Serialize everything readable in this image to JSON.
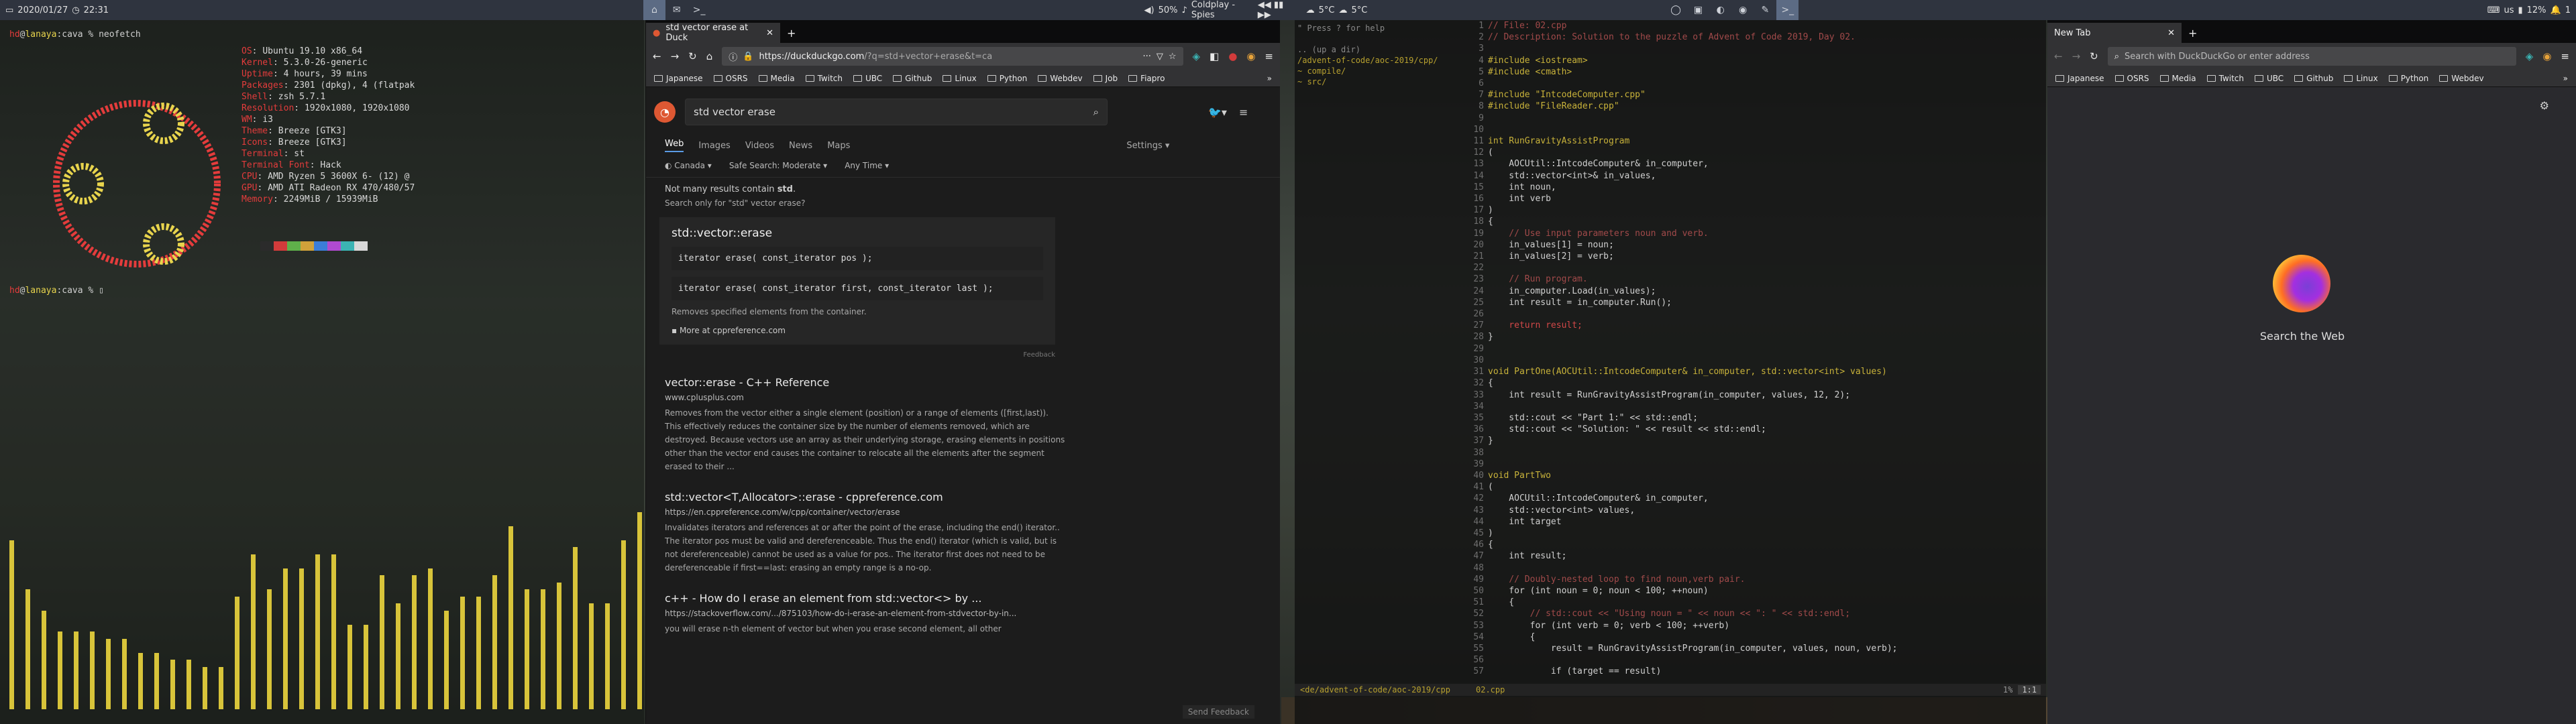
{
  "topbar": {
    "date": "2020/01/27",
    "time": "22:31",
    "media": {
      "volume": "50%",
      "song": "Coldplay - Spies"
    },
    "weather1": "5°C",
    "weather2": "5°C",
    "tray": {
      "keyboard": "us",
      "battery": "12%",
      "notifications": "1"
    }
  },
  "terminal1": {
    "prompt_cmd": "neofetch",
    "user": "hd",
    "host": "lanaya",
    "sep": "@",
    "dir": "cava",
    "info": [
      {
        "k": "OS",
        "v": "Ubuntu 19.10 x86_64"
      },
      {
        "k": "Kernel",
        "v": "5.3.0-26-generic"
      },
      {
        "k": "Uptime",
        "v": "4 hours, 39 mins"
      },
      {
        "k": "Packages",
        "v": "2301 (dpkg), 4 (flatpak"
      },
      {
        "k": "Shell",
        "v": "zsh 5.7.1"
      },
      {
        "k": "Resolution",
        "v": "1920x1080, 1920x1080"
      },
      {
        "k": "WM",
        "v": "i3"
      },
      {
        "k": "Theme",
        "v": "Breeze [GTK3]"
      },
      {
        "k": "Icons",
        "v": "Breeze [GTK3]"
      },
      {
        "k": "Terminal",
        "v": "st"
      },
      {
        "k": "Terminal Font",
        "v": "Hack"
      },
      {
        "k": "CPU",
        "v": "AMD Ryzen 5 3600X 6- (12) @"
      },
      {
        "k": "GPU",
        "v": "AMD ATI Radeon RX 470/480/57"
      },
      {
        "k": "Memory",
        "v": "2249MiB / 15939MiB"
      }
    ],
    "palette": [
      "#2b2b2b",
      "#d23b3b",
      "#5fb04a",
      "#d0a13a",
      "#3b7dd8",
      "#b04ad0",
      "#3bb3b3",
      "#d8d8d8",
      "#555555",
      "#ff5555",
      "#7fd06a",
      "#f0c050",
      "#5b9df8",
      "#d06af0",
      "#5bd3d3",
      "#ffffff"
    ],
    "visualizer": [
      0.24,
      0.17,
      0.14,
      0.11,
      0.11,
      0.11,
      0.1,
      0.1,
      0.08,
      0.08,
      0.07,
      0.07,
      0.06,
      0.06,
      0.16,
      0.22,
      0.17,
      0.2,
      0.2,
      0.22,
      0.22,
      0.12,
      0.12,
      0.19,
      0.15,
      0.19,
      0.2,
      0.14,
      0.16,
      0.16,
      0.19,
      0.26,
      0.17,
      0.17,
      0.18,
      0.23,
      0.15,
      0.15,
      0.24,
      0.28
    ]
  },
  "browser": {
    "tab_title": "std vector erase at Duck",
    "url_host": "https://duckduckgo.com",
    "url_path": "/?q=std+vector+erase&t=ca",
    "bookmarks": [
      "Japanese",
      "OSRS",
      "Media",
      "Twitch",
      "UBC",
      "Github",
      "Linux",
      "Python",
      "Webdev",
      "Job",
      "Fiapro"
    ],
    "search": "std vector erase",
    "tabs": [
      "Web",
      "Images",
      "Videos",
      "News",
      "Maps"
    ],
    "settings": "Settings",
    "filters": [
      "Canada",
      "Safe Search: Moderate",
      "Any Time"
    ],
    "notice1": "Not many results contain",
    "notice1_term": "std",
    "notice2": "Search only for \"std\" vector erase?",
    "card": {
      "title": "std::vector::erase",
      "code1": "iterator erase( const_iterator pos );",
      "code2": "iterator erase( const_iterator first, const_iterator last );",
      "desc": "Removes specified elements from the container.",
      "more": "More at cppreference.com",
      "feedback": "Feedback"
    },
    "results": [
      {
        "title": "vector::erase - C++ Reference",
        "url": "www.cplusplus.com",
        "snippet": "Removes from the vector either a single element (position) or a range of elements ([first,last)). This effectively reduces the container size by the number of elements removed, which are destroyed. Because vectors use an array as their underlying storage, erasing elements in positions other than the vector end causes the container to relocate all the elements after the segment erased to their ..."
      },
      {
        "title": "std::vector<T,Allocator>::erase - cppreference.com",
        "url": "https://en.cppreference.com/w/cpp/container/vector/erase",
        "snippet": "Invalidates iterators and references at or after the point of the erase, including the end() iterator.. The iterator pos must be valid and dereferenceable. Thus the end() iterator (which is valid, but is not dereferenceable) cannot be used as a value for pos.. The iterator first does not need to be dereferenceable if first==last: erasing an empty range is a no-op."
      },
      {
        "title": "c++ - How do I erase an element from std::vector<> by ...",
        "url": "https://stackoverflow.com/.../875103/how-do-i-erase-an-element-from-stdvector-by-in...",
        "snippet": "you will erase n-th element of vector but when you erase second element, all other"
      }
    ],
    "send_feedback": "Send Feedback"
  },
  "editor": {
    "tree_help": "\" Press ? for help",
    "tree": [
      ".. (up a dir)",
      "/advent-of-code/aoc-2019/cpp/",
      "~ compile/",
      "~ src/"
    ],
    "lines": [
      {
        "n": "1",
        "t": "// File: 02.cpp",
        "c": "cm"
      },
      {
        "n": "2",
        "t": "// Description: Solution to the puzzle of Advent of Code 2019, Day 02.",
        "c": "cm"
      },
      {
        "n": "3",
        "t": "",
        "c": ""
      },
      {
        "n": "4",
        "t": "#include <iostream>",
        "c": "pp"
      },
      {
        "n": "5",
        "t": "#include <cmath>",
        "c": "pp"
      },
      {
        "n": "6",
        "t": "",
        "c": ""
      },
      {
        "n": "7",
        "t": "#include \"IntcodeComputer.cpp\"",
        "c": "pp"
      },
      {
        "n": "8",
        "t": "#include \"FileReader.cpp\"",
        "c": "pp"
      },
      {
        "n": "9",
        "t": "",
        "c": ""
      },
      {
        "n": "10",
        "t": "",
        "c": ""
      },
      {
        "n": "11",
        "t": "int RunGravityAssistProgram",
        "c": "kw"
      },
      {
        "n": "12",
        "t": "(",
        "c": ""
      },
      {
        "n": "13",
        "t": "    AOCUtil::IntcodeComputer& in_computer,",
        "c": ""
      },
      {
        "n": "14",
        "t": "    std::vector<int>& in_values,",
        "c": ""
      },
      {
        "n": "15",
        "t": "    int noun,",
        "c": ""
      },
      {
        "n": "16",
        "t": "    int verb",
        "c": ""
      },
      {
        "n": "17",
        "t": ")",
        "c": ""
      },
      {
        "n": "18",
        "t": "{",
        "c": ""
      },
      {
        "n": "19",
        "t": "    // Use input parameters noun and verb.",
        "c": "cm"
      },
      {
        "n": "20",
        "t": "    in_values[1] = noun;",
        "c": ""
      },
      {
        "n": "21",
        "t": "    in_values[2] = verb;",
        "c": ""
      },
      {
        "n": "22",
        "t": "",
        "c": ""
      },
      {
        "n": "23",
        "t": "    // Run program.",
        "c": "cm"
      },
      {
        "n": "24",
        "t": "    in_computer.Load(in_values);",
        "c": ""
      },
      {
        "n": "25",
        "t": "    int result = in_computer.Run();",
        "c": ""
      },
      {
        "n": "26",
        "t": "",
        "c": ""
      },
      {
        "n": "27",
        "t": "    return result;",
        "c": "ret"
      },
      {
        "n": "28",
        "t": "}",
        "c": ""
      },
      {
        "n": "29",
        "t": "",
        "c": ""
      },
      {
        "n": "30",
        "t": "",
        "c": ""
      },
      {
        "n": "31",
        "t": "void PartOne(AOCUtil::IntcodeComputer& in_computer, std::vector<int> values)",
        "c": "kw"
      },
      {
        "n": "32",
        "t": "{",
        "c": ""
      },
      {
        "n": "33",
        "t": "    int result = RunGravityAssistProgram(in_computer, values, 12, 2);",
        "c": ""
      },
      {
        "n": "34",
        "t": "",
        "c": ""
      },
      {
        "n": "35",
        "t": "    std::cout << \"Part 1:\" << std::endl;",
        "c": ""
      },
      {
        "n": "36",
        "t": "    std::cout << \"Solution: \" << result << std::endl;",
        "c": ""
      },
      {
        "n": "37",
        "t": "}",
        "c": ""
      },
      {
        "n": "38",
        "t": "",
        "c": ""
      },
      {
        "n": "39",
        "t": "",
        "c": ""
      },
      {
        "n": "40",
        "t": "void PartTwo",
        "c": "kw"
      },
      {
        "n": "41",
        "t": "(",
        "c": ""
      },
      {
        "n": "42",
        "t": "    AOCUtil::IntcodeComputer& in_computer,",
        "c": ""
      },
      {
        "n": "43",
        "t": "    std::vector<int> values,",
        "c": ""
      },
      {
        "n": "44",
        "t": "    int target",
        "c": ""
      },
      {
        "n": "45",
        "t": ")",
        "c": ""
      },
      {
        "n": "46",
        "t": "{",
        "c": ""
      },
      {
        "n": "47",
        "t": "    int result;",
        "c": ""
      },
      {
        "n": "48",
        "t": "",
        "c": ""
      },
      {
        "n": "49",
        "t": "    // Doubly-nested loop to find noun,verb pair.",
        "c": "cm"
      },
      {
        "n": "50",
        "t": "    for (int noun = 0; noun < 100; ++noun)",
        "c": ""
      },
      {
        "n": "51",
        "t": "    {",
        "c": ""
      },
      {
        "n": "52",
        "t": "        // std::cout << \"Using noun = \" << noun << \": \" << std::endl;",
        "c": "cm"
      },
      {
        "n": "53",
        "t": "        for (int verb = 0; verb < 100; ++verb)",
        "c": ""
      },
      {
        "n": "54",
        "t": "        {",
        "c": ""
      },
      {
        "n": "55",
        "t": "            result = RunGravityAssistProgram(in_computer, values, noun, verb);",
        "c": ""
      },
      {
        "n": "56",
        "t": "",
        "c": ""
      },
      {
        "n": "57",
        "t": "            if (target == result)",
        "c": ""
      }
    ],
    "status_left": "<de/advent-of-code/aoc-2019/cpp",
    "status_file": "02.cpp",
    "status_pct": "1%",
    "status_pos": "1:1"
  },
  "newtab": {
    "tab_title": "New Tab",
    "url_placeholder": "Search with DuckDuckGo or enter address",
    "bookmarks": [
      "Japanese",
      "OSRS",
      "Media",
      "Twitch",
      "UBC",
      "Github",
      "Linux",
      "Python",
      "Webdev"
    ],
    "search_label": "Search the Web"
  }
}
